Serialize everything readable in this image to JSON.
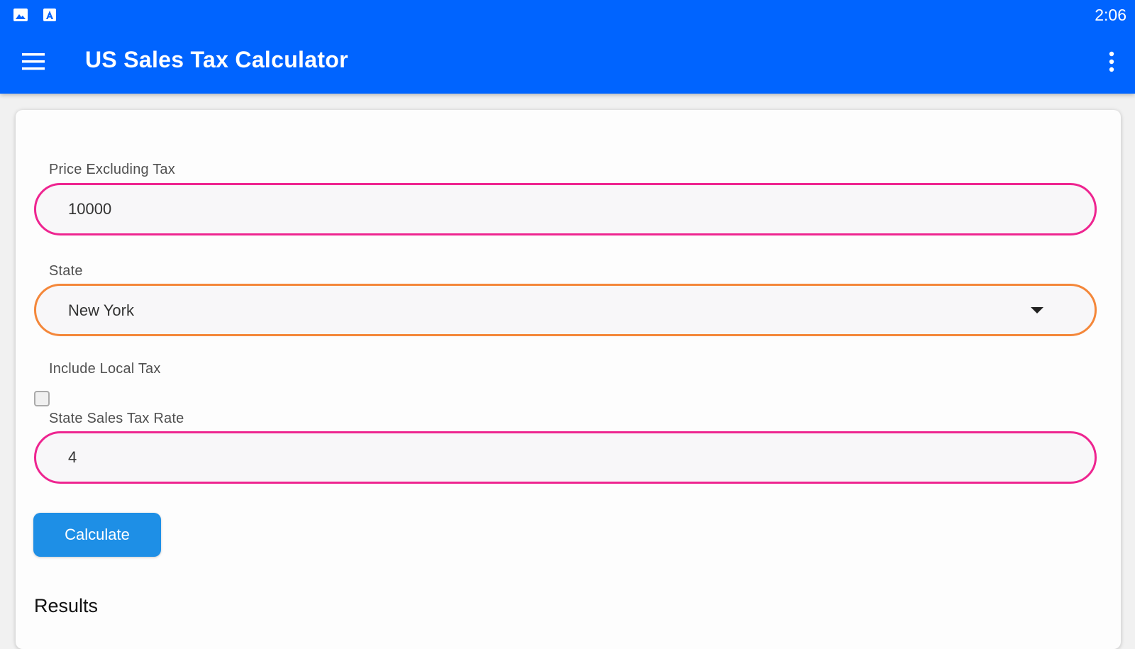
{
  "status_bar": {
    "time": "2:06",
    "icons": [
      "photo-icon",
      "a-letter-icon"
    ]
  },
  "app_bar": {
    "title": "US Sales Tax Calculator",
    "menu_icon": "hamburger-menu-icon",
    "more_icon": "more-vertical-icon",
    "color": "#0064ff"
  },
  "form": {
    "price": {
      "label": "Price Excluding Tax",
      "value": "10000"
    },
    "state": {
      "label": "State",
      "selected": "New York"
    },
    "local_tax": {
      "label": "Include Local Tax",
      "checked": false
    },
    "rate": {
      "label": "State Sales Tax Rate",
      "value": "4"
    },
    "calculate_label": "Calculate"
  },
  "results": {
    "heading": "Results"
  },
  "colors": {
    "input_border": "#ee2590",
    "select_border": "#f4873a",
    "button": "#1e8fe6"
  }
}
